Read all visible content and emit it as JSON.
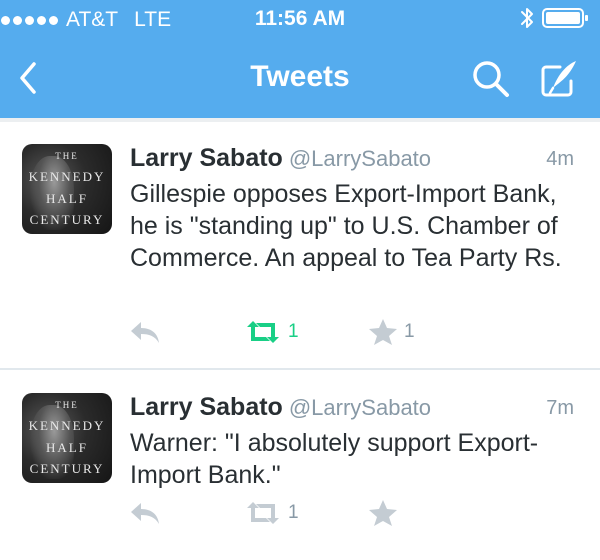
{
  "status_bar": {
    "carrier": "AT&T",
    "network": "LTE",
    "time": "11:56 AM"
  },
  "nav": {
    "title": "Tweets",
    "back_icon": "chevron-left-icon",
    "search_icon": "search-icon",
    "compose_icon": "compose-quill-icon"
  },
  "colors": {
    "header_bg": "#55acee",
    "retweet_active": "#19cf86",
    "meta_gray": "#8899a6"
  },
  "avatar_text": [
    "THE",
    "KENNEDY",
    "HALF",
    "CENTURY"
  ],
  "tweets": [
    {
      "name": "Larry Sabato",
      "handle": "@LarrySabato",
      "time": "4m",
      "text": "Gillespie opposes Export-Import Bank, he is \"standing up\" to U.S. Chamber of Commerce. An appeal to Tea Party Rs.",
      "retweets": "1",
      "favorites": "1",
      "retweeted": true
    },
    {
      "name": "Larry Sabato",
      "handle": "@LarrySabato",
      "time": "7m",
      "text": "Warner: \"I absolutely support Export-Import Bank.\"",
      "retweets": "1",
      "favorites": "",
      "retweeted": false
    }
  ]
}
